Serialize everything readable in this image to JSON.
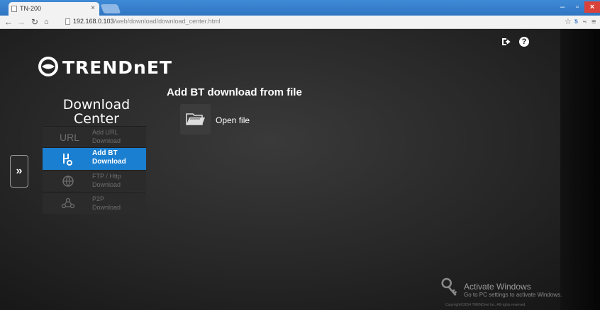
{
  "browser": {
    "tab_title": "TN-200",
    "tab_close": "×",
    "url_host": "192.168.0.103",
    "url_path": "/web/download/download_center.html",
    "window_controls": {
      "minimize": "–",
      "maximize": "▫",
      "close": "×"
    },
    "nav_icons": [
      "back-icon",
      "forward-icon",
      "reload-icon",
      "home-icon"
    ],
    "toolbar_icons": [
      "star-icon",
      "extension-icon",
      "menu-icon"
    ]
  },
  "app": {
    "brand": "TRENDnET",
    "download_center_title": [
      "Download",
      "Center"
    ],
    "menu": [
      {
        "id": "url",
        "label": [
          "Add URL",
          "Download"
        ],
        "icon": "url-icon",
        "active": false
      },
      {
        "id": "bt",
        "label": [
          "Add BT",
          "Download"
        ],
        "icon": "bt-icon",
        "active": true
      },
      {
        "id": "ftp",
        "label": [
          "FTP / Http",
          "Download"
        ],
        "icon": "globe-icon",
        "active": false
      },
      {
        "id": "p2p",
        "label": [
          "P2P",
          "Download"
        ],
        "icon": "p2p-icon",
        "active": false
      }
    ],
    "url_icon_text": "URL",
    "page_heading": "Add BT download from file",
    "open_file_label": "Open file",
    "side_toggle": "»",
    "top_icons": [
      "logout-icon",
      "help-icon"
    ],
    "help_glyph": "?"
  },
  "watermark": {
    "title": "Activate Windows",
    "subtitle": "Go to PC settings to activate Windows.",
    "copyright": "Copyright©2014 TRENDnet Inc. All rights reserved."
  },
  "colors": {
    "accent": "#1a7fd0",
    "background": "#2a2a2a",
    "tabbar": "#3f8bd6"
  }
}
